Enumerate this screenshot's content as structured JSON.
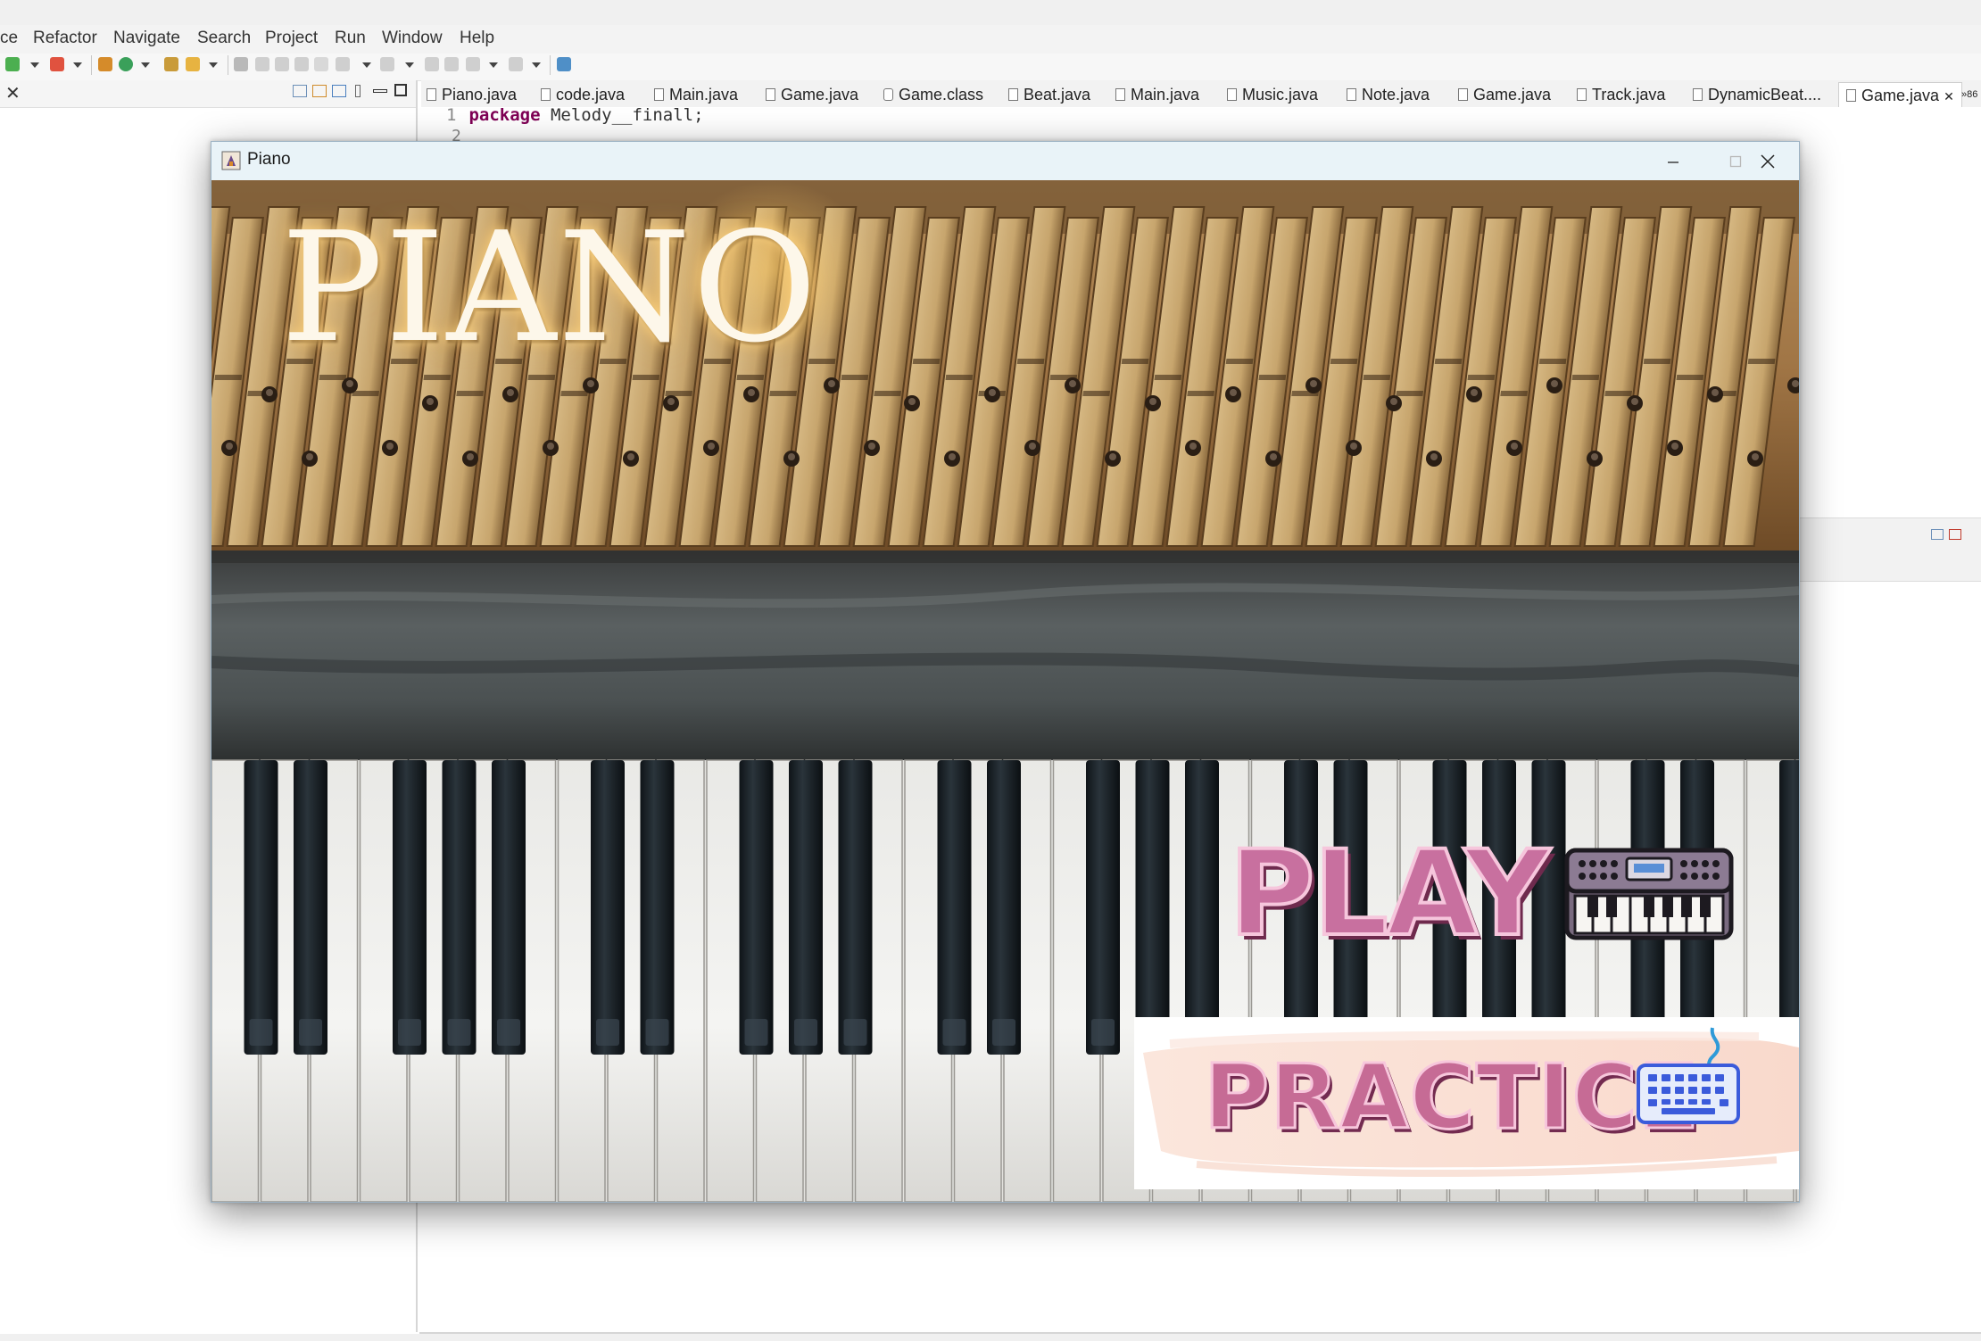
{
  "ide": {
    "menus": [
      "ce",
      "Refactor",
      "Navigate",
      "Search",
      "Project",
      "Run",
      "Window",
      "Help"
    ],
    "editor_tabs": [
      "Piano.java",
      "code.java",
      "Main.java",
      "Game.java",
      "Game.class",
      "Beat.java",
      "Main.java",
      "Music.java",
      "Note.java",
      "Game.java",
      "Track.java",
      "DynamicBeat....",
      "Game.java"
    ],
    "active_tab_close": "✕",
    "overflow_label": "»86",
    "left_close": "✕",
    "code": {
      "line1_number": "1",
      "line1_keyword": "package",
      "line1_rest": " Melody__finall;",
      "line2_number": "2"
    }
  },
  "window": {
    "title": "Piano",
    "controls": [
      "minimize-button",
      "maximize-button",
      "close-button"
    ]
  },
  "app": {
    "title": "PIANO",
    "play_label": "PLAY",
    "practice_label": "PRACTICE"
  },
  "colors": {
    "title_glow": "#ffd682",
    "button_pink": "#c8709f",
    "button_shadow": "#6e2a4d",
    "practice_panel": "#ffffff",
    "keyboard_icon": "#3b5bdb",
    "titlebar": "#e9f3f8"
  },
  "icons": {
    "play_icon": "synthesizer-icon",
    "practice_icon": "computer-keyboard-icon"
  }
}
